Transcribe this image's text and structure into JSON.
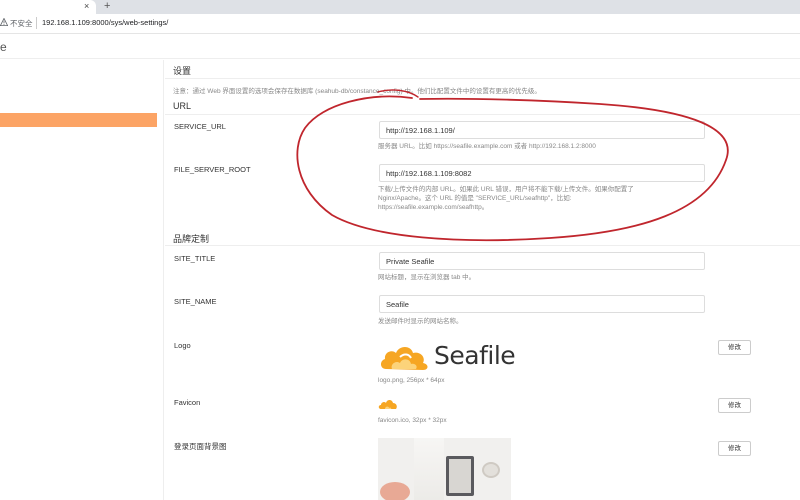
{
  "browser": {
    "tab_close": "×",
    "new_tab": "+",
    "not_secure": "不安全",
    "url": "192.168.1.109:8000/sys/web-settings/"
  },
  "app": {
    "partial_title": "e"
  },
  "settings": {
    "title": "设置",
    "note": "注意：通过 Web 界面设置的选项会保存在数据库 (seahub-db/constance_config) 中。他们比配置文件中的设置有更高的优先级。",
    "sections": {
      "url": {
        "title": "URL",
        "service_url": {
          "label": "SERVICE_URL",
          "value": "http://192.168.1.109/",
          "help": "服务器 URL。比如 https://seafile.example.com 或者 http://192.168.1.2:8000"
        },
        "file_server_root": {
          "label": "FILE_SERVER_ROOT",
          "value": "http://192.168.1.109:8082",
          "help_line1": "下载/上传文件的内部 URL。如果此 URL 错误，用户将不能下载/上传文件。如果你配置了",
          "help_line2": "Nginx/Apache。这个 URL 的值是 \"SERVICE_URL/seafhttp\"，比如:",
          "help_line3": "https://seafile.example.com/seafhttp。"
        }
      },
      "branding": {
        "title": "品牌定制",
        "site_title": {
          "label": "SITE_TITLE",
          "value": "Private Seafile",
          "help": "网站标题，显示在浏览器 tab 中。"
        },
        "site_name": {
          "label": "SITE_NAME",
          "value": "Seafile",
          "help": "发送邮件时显示的网站名称。"
        },
        "logo": {
          "label": "Logo",
          "logo_text": "Seafile",
          "caption": "logo.png, 256px * 64px",
          "button": "修改"
        },
        "favicon": {
          "label": "Favicon",
          "caption": "favicon.ico, 32px * 32px",
          "button": "修改"
        },
        "login_bg": {
          "label": "登录页面背景图",
          "button": "修改"
        }
      }
    }
  },
  "colors": {
    "sidebar_active": "#fca465",
    "annotation": "#c0262d",
    "logo_cloud": "#f6a623"
  }
}
